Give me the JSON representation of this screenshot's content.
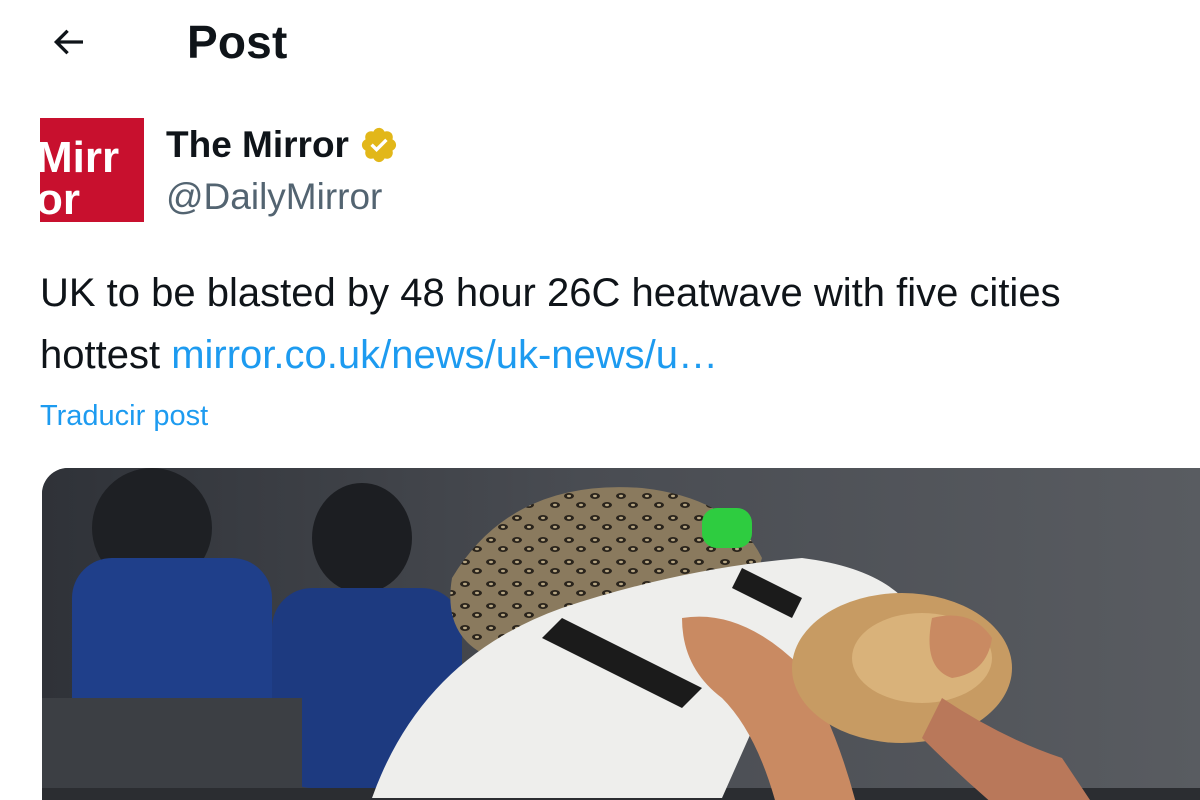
{
  "header": {
    "back_icon": "arrow-left-icon",
    "title": "Post"
  },
  "author": {
    "avatar_text_top": "Mirr",
    "avatar_text_bottom": "or",
    "name": "The Mirror",
    "verified_icon": "verified-badge-icon",
    "handle": "@DailyMirror"
  },
  "post": {
    "text_line1": "UK to be blasted by 48 hour 26C heatwave with five cities",
    "text_line2_prefix": "hottest ",
    "link_text": "mirror.co.uk/news/uk-news/u…",
    "translate_label": "Traducir post"
  },
  "colors": {
    "accent": "#1d9bf0",
    "brand_red": "#c8102e",
    "verified_gold": "#e2b719",
    "secondary_text": "#536471"
  }
}
